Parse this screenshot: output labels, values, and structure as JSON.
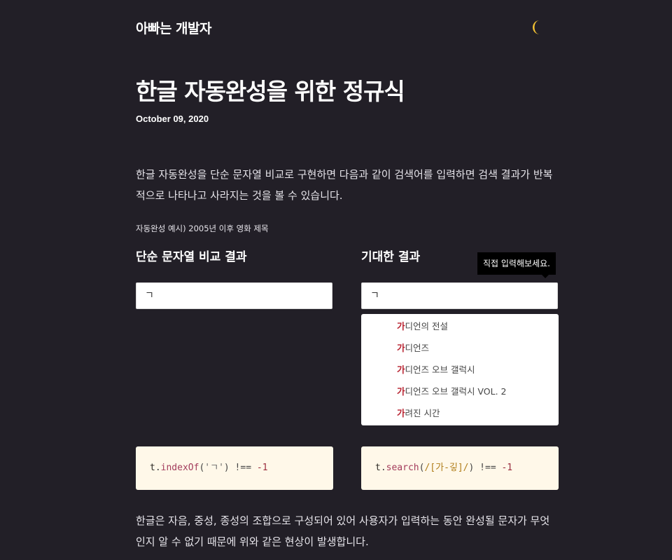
{
  "header": {
    "site_title": "아빠는 개발자",
    "theme_icon": "crescent-moon"
  },
  "post": {
    "title": "한글 자동완성을 위한 정규식",
    "date": "October 09, 2020",
    "intro": "한글 자동완성을 단순 문자열 비교로 구현하면 다음과 같이 검색어를 입력하면 검색 결과가 반복적으로 나타나고 사라지는 것을 볼 수 있습니다.",
    "example_caption": "자동완성 예시) 2005년 이후 영화 제목",
    "conclusion": "한글은 자음, 중성, 종성의 조합으로 구성되어 있어 사용자가 입력하는 동안 완성될 문자가 무엇인지 알 수 없기 때문에 위와 같은 현상이 발생합니다."
  },
  "demo": {
    "left": {
      "heading": "단순 문자열 비교 결과",
      "input_value": "ㄱ",
      "code": {
        "obj": "t",
        "dot": ".",
        "fn": "indexOf",
        "open": "(",
        "arg": "'ㄱ'",
        "close": ")",
        "op": " !== ",
        "num": "-1"
      }
    },
    "right": {
      "heading": "기대한 결과",
      "tooltip": "직접 입력해보세요.",
      "input_value": "ㄱ",
      "suggestions": [
        {
          "match": "가",
          "rest": "디언의 전설"
        },
        {
          "match": "가",
          "rest": "디언즈"
        },
        {
          "match": "가",
          "rest": "디언즈 오브 갤럭시"
        },
        {
          "match": "가",
          "rest": "디언즈 오브 갤럭시 VOL. 2"
        },
        {
          "match": "가",
          "rest": "려진 시간"
        }
      ],
      "code": {
        "obj": "t",
        "dot": ".",
        "fn": "search",
        "open": "(",
        "arg": "/[가-깋]/",
        "close": ")",
        "op": " !== ",
        "num": "-1"
      }
    }
  },
  "colors": {
    "background": "#221f27",
    "highlight": "#b7202e",
    "code_bg": "#fff8e9",
    "moon": "#f3c233"
  }
}
